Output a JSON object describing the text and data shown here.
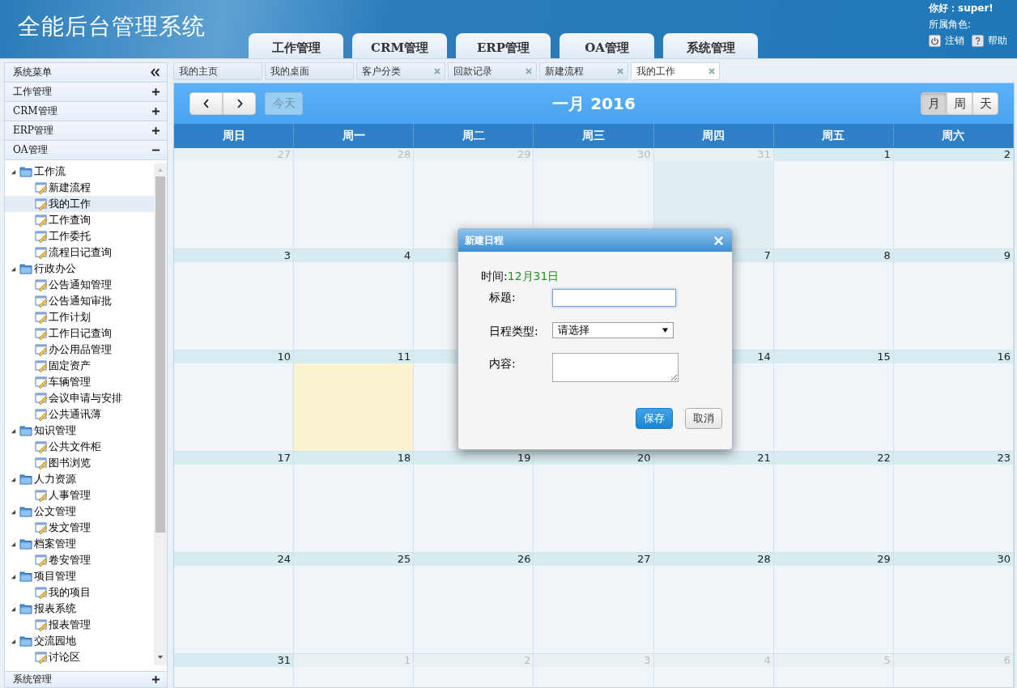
{
  "header": {
    "title": "全能后台管理系统",
    "greeting": "你好：super!",
    "role_label": "所属角色:",
    "logout": "注销",
    "help": "帮助"
  },
  "nav_tabs": [
    "工作管理",
    "CRM管理",
    "ERP管理",
    "OA管理",
    "系统管理"
  ],
  "sidebar": {
    "title": "系统菜单",
    "sections": [
      {
        "label": "工作管理",
        "expanded": false
      },
      {
        "label": "CRM管理",
        "expanded": false
      },
      {
        "label": "ERP管理",
        "expanded": false
      },
      {
        "label": "OA管理",
        "expanded": true
      }
    ],
    "tree": [
      {
        "label": "工作流",
        "expanded": true,
        "children": [
          {
            "label": "新建流程",
            "selected": false
          },
          {
            "label": "我的工作",
            "selected": true
          },
          {
            "label": "工作查询",
            "selected": false
          },
          {
            "label": "工作委托",
            "selected": false
          },
          {
            "label": "流程日记查询",
            "selected": false
          }
        ]
      },
      {
        "label": "行政办公",
        "expanded": true,
        "children": [
          {
            "label": "公告通知管理",
            "selected": false
          },
          {
            "label": "公告通知审批",
            "selected": false
          },
          {
            "label": "工作计划",
            "selected": false
          },
          {
            "label": "工作日记查询",
            "selected": false
          },
          {
            "label": "办公用品管理",
            "selected": false
          },
          {
            "label": "固定资产",
            "selected": false
          },
          {
            "label": "车辆管理",
            "selected": false
          },
          {
            "label": "会议申请与安排",
            "selected": false
          },
          {
            "label": "公共通讯薄",
            "selected": false
          }
        ]
      },
      {
        "label": "知识管理",
        "expanded": true,
        "children": [
          {
            "label": "公共文件柜",
            "selected": false
          },
          {
            "label": "图书浏览",
            "selected": false
          }
        ]
      },
      {
        "label": "人力资源",
        "expanded": true,
        "children": [
          {
            "label": "人事管理",
            "selected": false
          }
        ]
      },
      {
        "label": "公文管理",
        "expanded": true,
        "children": [
          {
            "label": "发文管理",
            "selected": false
          }
        ]
      },
      {
        "label": "档案管理",
        "expanded": true,
        "children": [
          {
            "label": "卷安管理",
            "selected": false
          }
        ]
      },
      {
        "label": "项目管理",
        "expanded": true,
        "children": [
          {
            "label": "我的项目",
            "selected": false
          }
        ]
      },
      {
        "label": "报表系统",
        "expanded": true,
        "children": [
          {
            "label": "报表管理",
            "selected": false
          }
        ]
      },
      {
        "label": "交流园地",
        "expanded": true,
        "children": [
          {
            "label": "讨论区",
            "selected": false
          }
        ]
      }
    ],
    "footer_section": {
      "label": "系统管理",
      "expanded": false
    }
  },
  "page_tabs": [
    {
      "label": "我的主页",
      "closable": false,
      "selected": false
    },
    {
      "label": "我的桌面",
      "closable": false,
      "selected": false
    },
    {
      "label": "客户分类",
      "closable": true,
      "selected": false
    },
    {
      "label": "回款记录",
      "closable": true,
      "selected": false
    },
    {
      "label": "新建流程",
      "closable": true,
      "selected": false
    },
    {
      "label": "我的工作",
      "closable": true,
      "selected": true
    }
  ],
  "calendar": {
    "title": "一月 2016",
    "today_button": {
      "label": "今天",
      "disabled": true
    },
    "views": [
      {
        "label": "月",
        "selected": true
      },
      {
        "label": "周",
        "selected": false
      },
      {
        "label": "天",
        "selected": false
      }
    ],
    "weekdays": [
      "周日",
      "周一",
      "周二",
      "周三",
      "周四",
      "周五",
      "周六"
    ],
    "weeks": [
      {
        "days": [
          {
            "label": "27",
            "other_month": true,
            "today": false,
            "selected": false
          },
          {
            "label": "28",
            "other_month": true,
            "today": false,
            "selected": false
          },
          {
            "label": "29",
            "other_month": true,
            "today": false,
            "selected": false
          },
          {
            "label": "30",
            "other_month": true,
            "today": false,
            "selected": false
          },
          {
            "label": "31",
            "other_month": true,
            "today": false,
            "selected": true
          },
          {
            "label": "1",
            "other_month": false,
            "today": false,
            "selected": false
          },
          {
            "label": "2",
            "other_month": false,
            "today": false,
            "selected": false
          }
        ]
      },
      {
        "days": [
          {
            "label": "3",
            "other_month": false,
            "today": false,
            "selected": false
          },
          {
            "label": "4",
            "other_month": false,
            "today": false,
            "selected": false
          }
        ],
        "days_after_dialog": [
          {
            "label": "7",
            "other_month": false,
            "today": false,
            "selected": false
          },
          {
            "label": "8",
            "other_month": false,
            "today": false,
            "selected": false
          },
          {
            "label": "9",
            "other_month": false,
            "today": false,
            "selected": false
          }
        ]
      },
      {
        "days": [
          {
            "label": "10",
            "other_month": false,
            "today": false,
            "selected": false
          },
          {
            "label": "11",
            "other_month": false,
            "today": true,
            "selected": false
          }
        ],
        "days_after_dialog": [
          {
            "label": "14",
            "other_month": false,
            "today": false,
            "selected": false
          },
          {
            "label": "15",
            "other_month": false,
            "today": false,
            "selected": false
          },
          {
            "label": "16",
            "other_month": false,
            "today": false,
            "selected": false
          }
        ]
      },
      {
        "days": [
          {
            "label": "17",
            "other_month": false,
            "today": false,
            "selected": false
          },
          {
            "label": "18",
            "other_month": false,
            "today": false,
            "selected": false
          },
          {
            "label": "19",
            "other_month": false,
            "today": false,
            "selected": false
          },
          {
            "label": "20",
            "other_month": false,
            "today": false,
            "selected": false
          },
          {
            "label": "21",
            "other_month": false,
            "today": false,
            "selected": false
          },
          {
            "label": "22",
            "other_month": false,
            "today": false,
            "selected": false
          },
          {
            "label": "23",
            "other_month": false,
            "today": false,
            "selected": false
          }
        ]
      },
      {
        "days": [
          {
            "label": "24",
            "other_month": false,
            "today": false,
            "selected": false
          },
          {
            "label": "25",
            "other_month": false,
            "today": false,
            "selected": false
          },
          {
            "label": "26",
            "other_month": false,
            "today": false,
            "selected": false
          },
          {
            "label": "27",
            "other_month": false,
            "today": false,
            "selected": false
          },
          {
            "label": "28",
            "other_month": false,
            "today": false,
            "selected": false
          },
          {
            "label": "29",
            "other_month": false,
            "today": false,
            "selected": false
          },
          {
            "label": "30",
            "other_month": false,
            "today": false,
            "selected": false
          }
        ]
      },
      {
        "days": [
          {
            "label": "31",
            "other_month": false,
            "today": false,
            "selected": false
          },
          {
            "label": "1",
            "other_month": true,
            "today": false,
            "selected": false
          },
          {
            "label": "2",
            "other_month": true,
            "today": false,
            "selected": false
          },
          {
            "label": "3",
            "other_month": true,
            "today": false,
            "selected": false
          },
          {
            "label": "4",
            "other_month": true,
            "today": false,
            "selected": false
          },
          {
            "label": "5",
            "other_month": true,
            "today": false,
            "selected": false
          },
          {
            "label": "6",
            "other_month": true,
            "today": false,
            "selected": false
          }
        ]
      }
    ]
  },
  "dialog": {
    "title": "新建日程",
    "time_label": "时间:",
    "time_value": "12月31日",
    "title_label": "标题:",
    "type_label": "日程类型:",
    "type_value": "请选择",
    "content_label": "内容:",
    "save": "保存",
    "cancel": "取消"
  }
}
